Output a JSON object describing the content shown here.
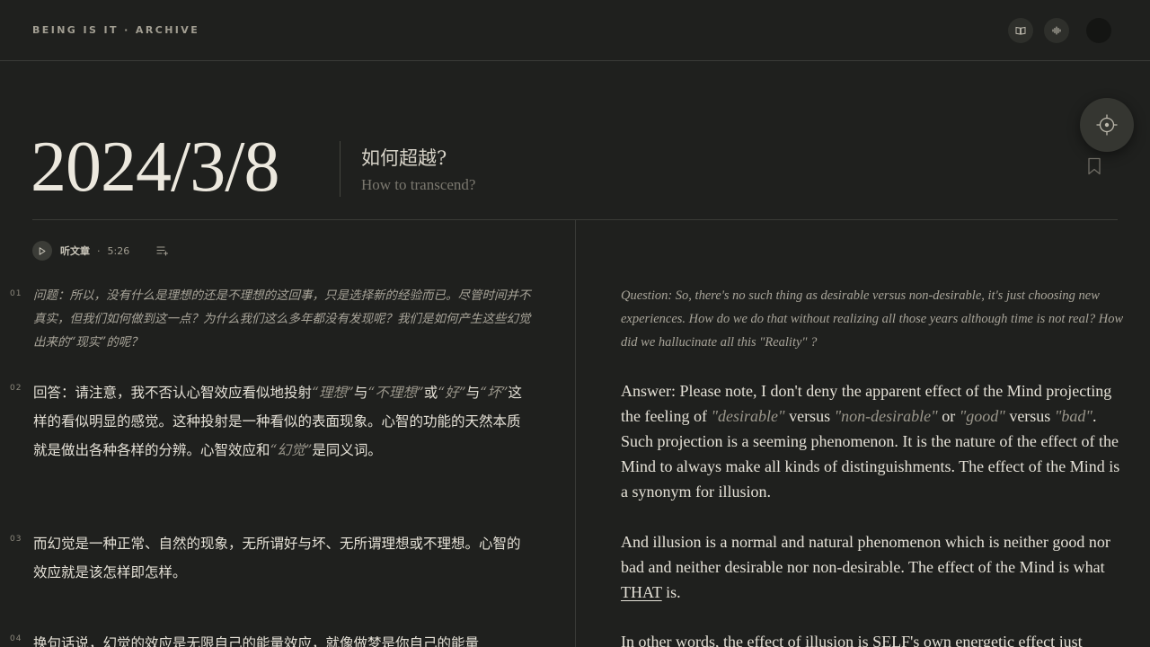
{
  "header": {
    "brand": "BEING IS IT · ARCHIVE",
    "buttons": [
      "book-icon",
      "audio-wave-icon",
      "avatar"
    ]
  },
  "article": {
    "date": "2024/3/8",
    "title_zh": "如何超越?",
    "title_en": "How to transcend?"
  },
  "audio": {
    "label": "听文章",
    "separator": "·",
    "duration": "5:26"
  },
  "paragraphs": [
    {
      "num": "01",
      "zh": "问题：所以，没有什么是理想的还是不理想的这回事，只是选择新的经验而已。尽管时间并不真实，但我们如何做到这一点？为什么我们这么多年都没有发现呢？我们是如何产生这些幻觉出来的“现实”的呢？",
      "en": "Question: So, there's no such thing as desirable versus non-desirable, it's just choosing new experiences. How do we do that without realizing all those years although time is not real? How did we hallucinate all this \"Reality\" ?"
    },
    {
      "num": "02",
      "zh": {
        "p1": "回答：请注意，我不否认心智效应看似地投射",
        "q1": "“理想”",
        "p2": "与",
        "q2": "“不理想”",
        "p3": "或",
        "q3": "“好”",
        "p4": "与",
        "q4": "“坏”",
        "p5": "这样的看似明显的感觉。这种投射是一种看似的表面现象。心智的功能的天然本质就是做出各种各样的分辨。心智效应和",
        "q5": "“幻觉”",
        "p6": "是同义词。"
      },
      "en": {
        "p1": "Answer: Please note, I don't deny the apparent effect of the Mind projecting the feeling of ",
        "q1": "\"desirable\"",
        "p2": " versus ",
        "q2": "\"non-desirable\"",
        "p3": " or ",
        "q3": "\"good\"",
        "p4": " versus ",
        "q4": "\"bad\"",
        "p5": ". Such projection is a seeming phenomenon. It is the nature of the effect of the Mind to always make all kinds of distinguishments. The effect of the Mind is a synonym for illusion."
      }
    },
    {
      "num": "03",
      "zh": "而幻觉是一种正常、自然的现象，无所谓好与坏、无所谓理想或不理想。心智的效应就是该怎样即怎样。",
      "en": {
        "p1": "And illusion is a normal and natural phenomenon which is neither good nor bad and neither desirable nor non-desirable. The effect of the Mind is what ",
        "u1": "THAT",
        "p2": " is."
      }
    },
    {
      "num": "04",
      "zh": "换句话说，幻觉的效应是无限自己的能量效应，就像做梦是你自己的能量",
      "en": "In other words, the effect of illusion is SELF's own energetic effect just"
    }
  ],
  "colors": {
    "background": "#1f201e",
    "text": "#e4e0d6",
    "muted": "#a8a499",
    "divider": "#3a3b37"
  }
}
